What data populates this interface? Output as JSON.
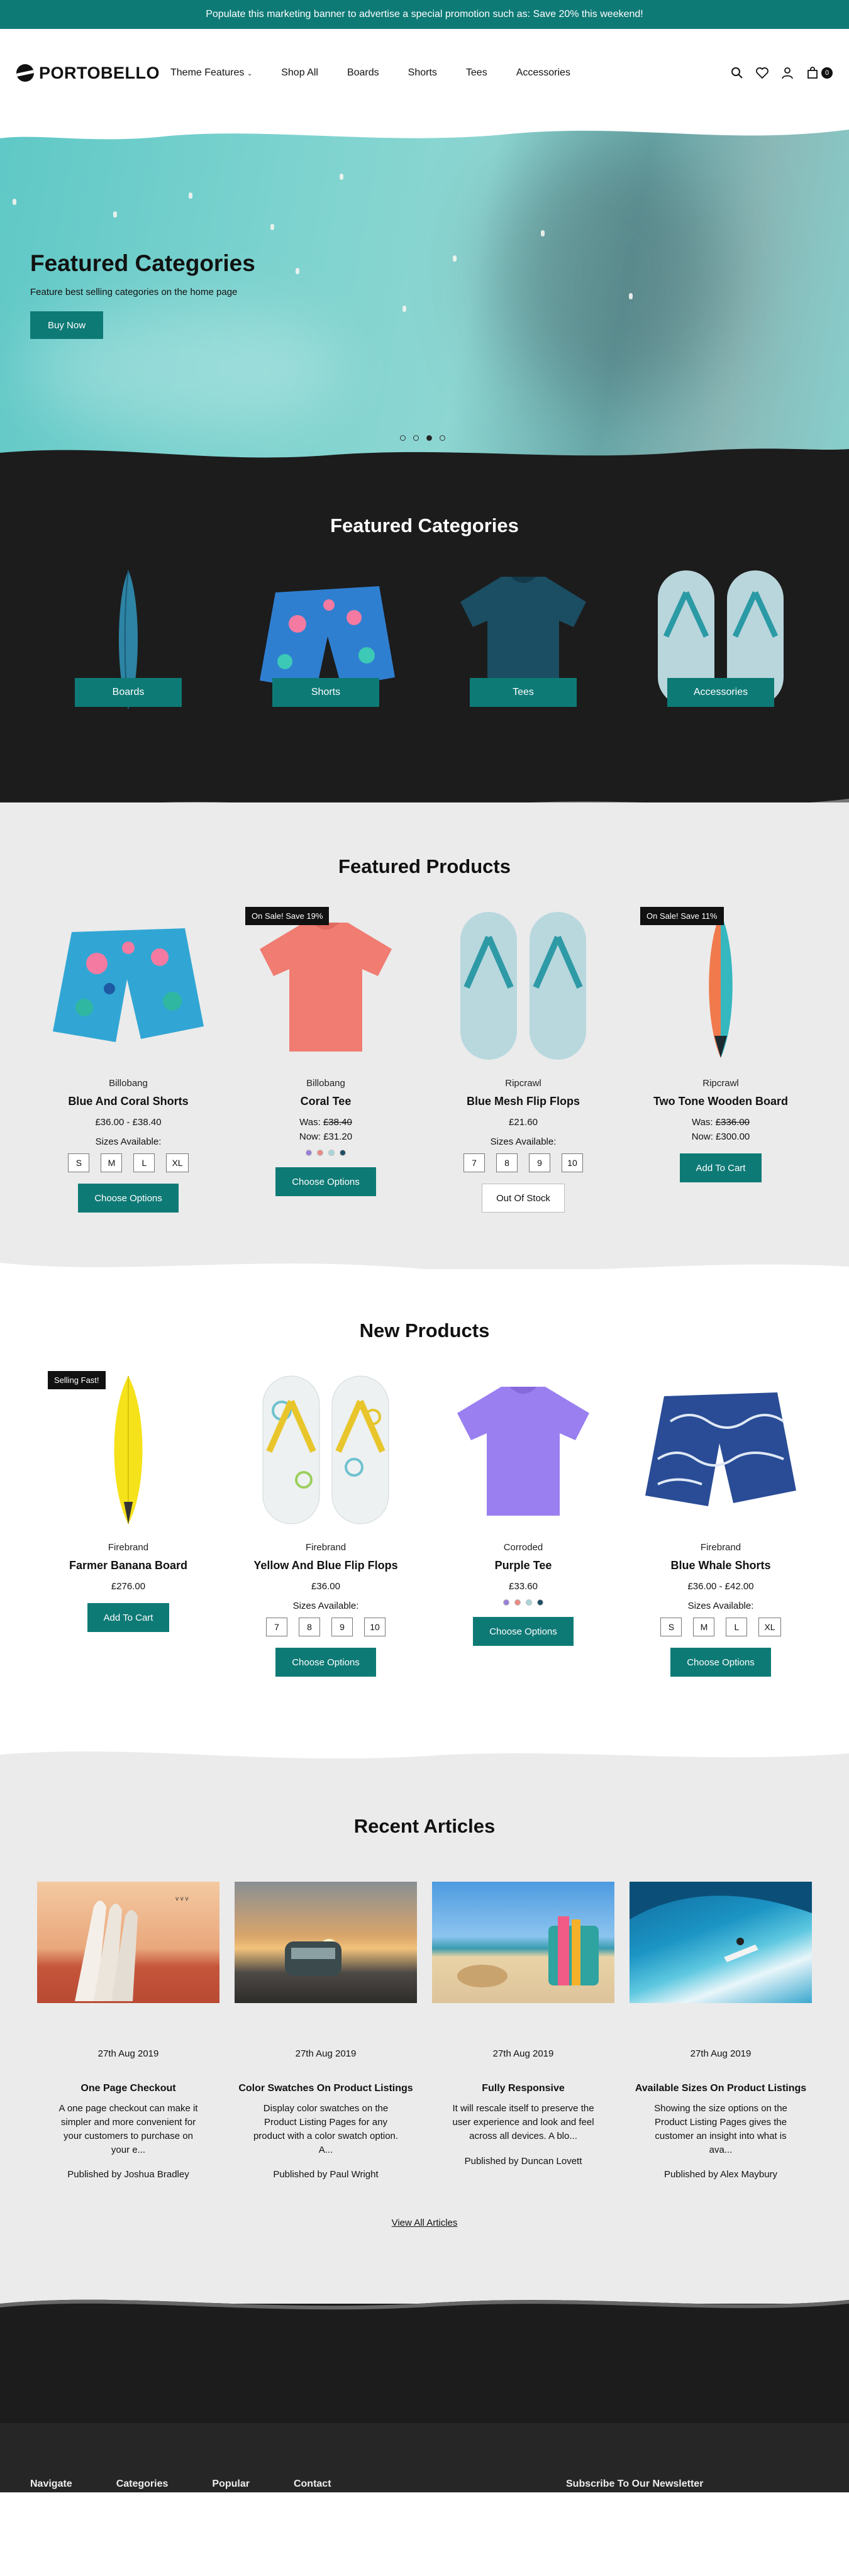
{
  "banner": {
    "text": "Populate this marketing banner to advertise a special promotion such as: Save 20% this weekend!"
  },
  "header": {
    "logo": "PORTOBELLO",
    "nav": [
      "Theme Features",
      "Shop All",
      "Boards",
      "Shorts",
      "Tees",
      "Accessories"
    ],
    "cart_count": "0"
  },
  "hero": {
    "title": "Featured Categories",
    "subtitle": "Feature best selling categories on the home page",
    "button": "Buy Now",
    "slides": 4,
    "active_slide": 3
  },
  "featured_categories": {
    "title": "Featured Categories",
    "items": [
      "Boards",
      "Shorts",
      "Tees",
      "Accessories"
    ]
  },
  "featured_products": {
    "title": "Featured Products",
    "items": [
      {
        "brand": "Billobang",
        "name": "Blue And Coral Shorts",
        "price": "£36.00 - £38.40",
        "sizes_label": "Sizes Available:",
        "sizes": [
          "S",
          "M",
          "L",
          "XL"
        ],
        "button": "Choose Options"
      },
      {
        "badge": "On Sale! Save 19%",
        "brand": "Billobang",
        "name": "Coral Tee",
        "was_label": "Was:",
        "was": "£38.40",
        "now": "Now: £31.20",
        "swatches": [
          "#9a7fd8",
          "#e98a84",
          "#a9d6dc",
          "#1f4f66"
        ],
        "button": "Choose Options"
      },
      {
        "brand": "Ripcrawl",
        "name": "Blue Mesh Flip Flops",
        "price": "£21.60",
        "sizes_label": "Sizes Available:",
        "sizes": [
          "7",
          "8",
          "9",
          "10"
        ],
        "button": "Out Of Stock"
      },
      {
        "badge": "On Sale! Save 11%",
        "brand": "Ripcrawl",
        "name": "Two Tone Wooden Board",
        "was_label": "Was:",
        "was": "£336.00",
        "now": "Now: £300.00",
        "button": "Add To Cart"
      }
    ]
  },
  "new_products": {
    "title": "New Products",
    "items": [
      {
        "badge": "Selling Fast!",
        "brand": "Firebrand",
        "name": "Farmer Banana Board",
        "price": "£276.00",
        "button": "Add To Cart"
      },
      {
        "brand": "Firebrand",
        "name": "Yellow And Blue Flip Flops",
        "price": "£36.00",
        "sizes_label": "Sizes Available:",
        "sizes": [
          "7",
          "8",
          "9",
          "10"
        ],
        "button": "Choose Options"
      },
      {
        "brand": "Corroded",
        "name": "Purple Tee",
        "price": "£33.60",
        "swatches": [
          "#9a7fd8",
          "#e98a84",
          "#a9d6dc",
          "#1f4f66"
        ],
        "button": "Choose Options"
      },
      {
        "brand": "Firebrand",
        "name": "Blue Whale Shorts",
        "price": "£36.00 - £42.00",
        "sizes_label": "Sizes Available:",
        "sizes": [
          "S",
          "M",
          "L",
          "XL"
        ],
        "button": "Choose Options"
      }
    ]
  },
  "articles": {
    "title": "Recent Articles",
    "items": [
      {
        "date": "27th Aug 2019",
        "title": "One Page Checkout",
        "excerpt": "A one page checkout can make it simpler and more convenient for your customers to purchase on your e...",
        "author": "Published by Joshua Bradley"
      },
      {
        "date": "27th Aug 2019",
        "title": "Color Swatches On Product Listings",
        "excerpt": "Display color swatches on the Product Listing Pages for any product with a color swatch option. A...",
        "author": "Published by Paul Wright"
      },
      {
        "date": "27th Aug 2019",
        "title": "Fully Responsive",
        "excerpt": "It will rescale itself to preserve the user experience and look and feel across all devices. A blo...",
        "author": "Published by Duncan Lovett"
      },
      {
        "date": "27th Aug 2019",
        "title": "Available Sizes On Product Listings",
        "excerpt": "Showing the size options on the Product Listing Pages gives the customer an insight into what is ava...",
        "author": "Published by Alex Maybury"
      }
    ],
    "view_all": "View All Articles"
  },
  "footer": {
    "columns": [
      "Navigate",
      "Categories",
      "Popular",
      "Contact"
    ],
    "subscribe": "Subscribe To Our Newsletter"
  }
}
